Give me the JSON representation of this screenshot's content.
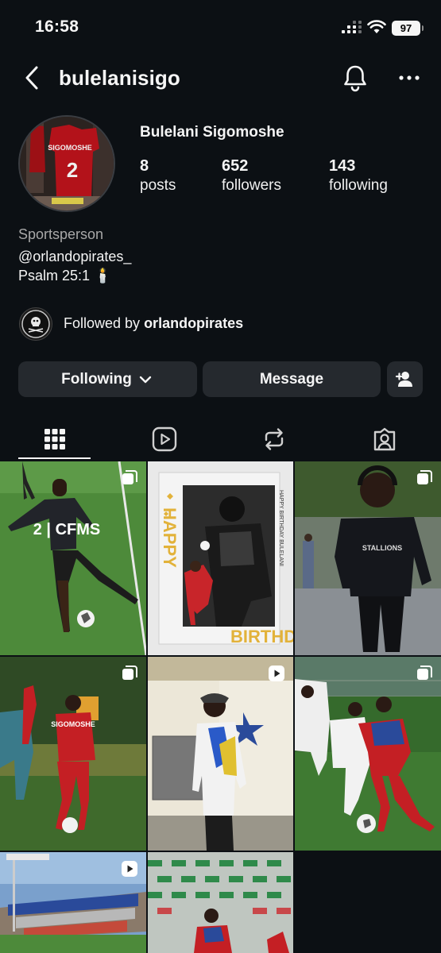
{
  "status_bar": {
    "time": "16:58",
    "battery": "97"
  },
  "header": {
    "username": "bulelanisigo",
    "back_icon": "chevron-left-icon",
    "bell_icon": "bell-icon",
    "more_icon": "more-horizontal-icon"
  },
  "profile": {
    "display_name": "Bulelani Sigomoshe",
    "stats": [
      {
        "value": "8",
        "label": "posts"
      },
      {
        "value": "652",
        "label": "followers"
      },
      {
        "value": "143",
        "label": "following"
      }
    ],
    "category": "Sportsperson",
    "bio_line1": "@orlandopirates_",
    "bio_line2": "Psalm 25:1 🕯️",
    "followed_by_prefix": "Followed by ",
    "followed_by_user": "orlandopirates"
  },
  "actions": {
    "following_label": "Following",
    "message_label": "Message",
    "add_user_icon": "add-user-icon"
  },
  "tabs": [
    {
      "icon": "grid-icon",
      "active": true
    },
    {
      "icon": "reels-icon",
      "active": false
    },
    {
      "icon": "reposts-icon",
      "active": false
    },
    {
      "icon": "tagged-icon",
      "active": false
    }
  ],
  "posts": [
    {
      "badge": "carousel-icon",
      "jersey_text": "2 | CFMS"
    },
    {
      "badge": "none",
      "poster_top": "HAPPY",
      "poster_bottom": "BIRTHDAY",
      "poster_side": "HAPPY BIRTHDAY BULELANI"
    },
    {
      "badge": "carousel-icon",
      "jacket_text": "STALLIONS"
    },
    {
      "badge": "carousel-icon",
      "jersey_text": "SIGOMOSHE"
    },
    {
      "badge": "reel-icon"
    },
    {
      "badge": "carousel-icon"
    },
    {
      "badge": "reel-icon"
    },
    {
      "badge": "none"
    }
  ],
  "colors": {
    "background": "#0c1014",
    "button": "#25292e",
    "secondary_text": "#a8a8a8"
  }
}
